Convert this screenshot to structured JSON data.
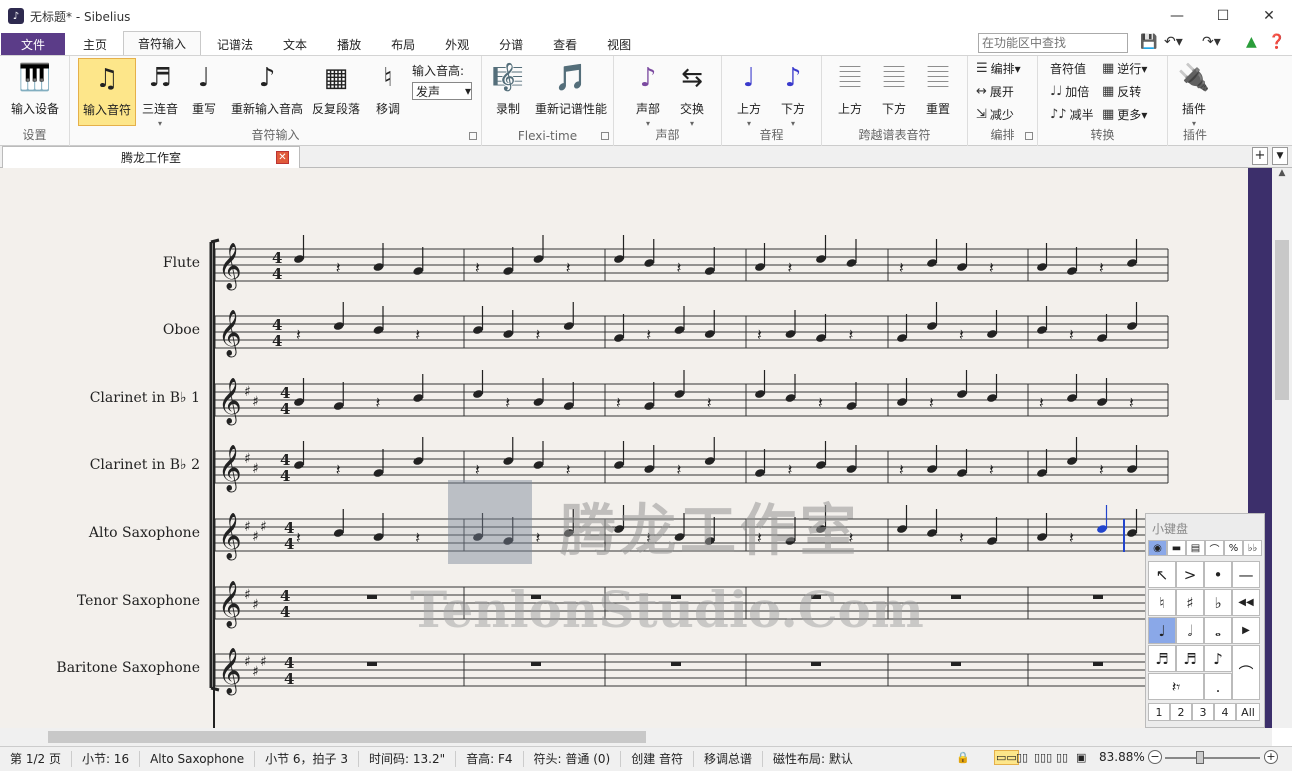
{
  "window": {
    "title": "无标题* - Sibelius",
    "minimize": "—",
    "maximize": "☐",
    "close": "✕"
  },
  "menu": {
    "tabs": [
      "文件",
      "主页",
      "音符输入",
      "记谱法",
      "文本",
      "播放",
      "布局",
      "外观",
      "分谱",
      "查看",
      "视图"
    ],
    "active": "音符输入"
  },
  "ribbon_search_placeholder": "在功能区中查找",
  "ribbon": {
    "groups": {
      "setup": "设置",
      "note_input": "音符输入",
      "flexi": "Flexi-time",
      "voice": "声部",
      "interval": "音程",
      "cross_staff": "跨越谱表音符",
      "edit": "编排",
      "convert": "转换",
      "plugins": "插件"
    },
    "buttons": {
      "input_device": "输入设备",
      "input_notes": "输入音符",
      "triplets": "三连音",
      "rewrite": "重写",
      "reinput_pitches": "重新输入音高",
      "repeat_bars": "反复段落",
      "transpose": "移调",
      "pitch_label": "输入音高:",
      "pitch_value": "发声",
      "record": "录制",
      "renotate": "重新记谱性能",
      "voice": "声部",
      "swap": "交换",
      "above": "上方",
      "below": "下方",
      "cross_above": "上方",
      "cross_below": "下方",
      "reset": "重置",
      "arrange": "编排",
      "expand": "展开",
      "reduce": "减少",
      "note_value": "音符值",
      "retrograde": "逆行",
      "double": "加倍",
      "invert": "反转",
      "halve": "减半",
      "more": "更多",
      "plugin": "插件"
    }
  },
  "document_tab": "腾龙工作室",
  "instruments": [
    "Flute",
    "Oboe",
    "Clarinet in B♭ 1",
    "Clarinet in B♭ 2",
    "Alto Saxophone",
    "Tenor Saxophone",
    "Baritone Saxophone"
  ],
  "watermark": {
    "cn": "腾龙工作室",
    "en": "TenlonStudio.Com"
  },
  "keypad": {
    "title": "小键盘",
    "tabs": [
      "1",
      "2",
      "3",
      "4",
      "All"
    ],
    "active_tab": "1"
  },
  "status": {
    "page": "第 1/2 页",
    "bars": "小节: 16",
    "instrument": "Alto Saxophone",
    "position": "小节 6，拍子 3",
    "timecode": "时间码: 13.2\"",
    "pitch": "音高: F4",
    "notehead": "符头: 普通 (0)",
    "mode": "创建 音符",
    "transposing": "移调总谱",
    "layout": "磁性布局: 默认",
    "zoom": "83.88%"
  },
  "colors": {
    "file_tab": "#5b3c88",
    "selected_button": "#fde68a",
    "score_bg": "#f3f0ec",
    "side_panel": "#3c2f6b",
    "selected_note": "#2244cc"
  }
}
